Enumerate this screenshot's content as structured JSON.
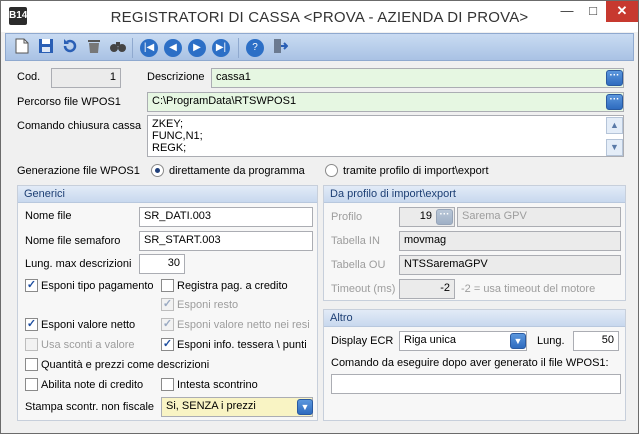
{
  "window": {
    "title": "REGISTRATORI DI CASSA <PROVA - AZIENDA DI PROVA>",
    "app_icon_text": "B14",
    "min_glyph": "—",
    "max_glyph": "□",
    "close_glyph": "✕"
  },
  "toolbar": {
    "icons": [
      "new-icon",
      "save-icon",
      "undo-icon",
      "delete-icon",
      "search-icon",
      "first-icon",
      "previous-icon",
      "next-icon",
      "last-icon",
      "help-icon",
      "exit-icon"
    ]
  },
  "cod": {
    "label": "Cod.",
    "value": "1"
  },
  "descrizione": {
    "label": "Descrizione",
    "value": "cassa1"
  },
  "percorso": {
    "label": "Percorso file WPOS1",
    "value": "C:\\ProgramData\\RTSWPOS1"
  },
  "comando_chiusura": {
    "label": "Comando chiusura cassa",
    "lines": [
      "ZKEY;",
      "FUNC,N1;",
      "REGK;"
    ]
  },
  "generazione": {
    "label": "Generazione file WPOS1",
    "option1": "direttamente da programma",
    "option2": "tramite profilo di import\\export",
    "selected": "option1"
  },
  "generici": {
    "header": "Generici",
    "nome_file_label": "Nome file",
    "nome_file_value": "SR_DATI.003",
    "semaforo_label": "Nome file semaforo",
    "semaforo_value": "SR_START.003",
    "lung_label": "Lung. max descrizioni",
    "lung_value": "30",
    "esponi_tipo_pagamento": "Esponi tipo pagamento",
    "registra_pag_credito": "Registra pag. a credito",
    "esponi_resto": "Esponi resto",
    "esponi_valore_netto": "Esponi valore netto",
    "esponi_valore_netto_resi": "Esponi valore netto nei resi",
    "usa_sconti": "Usa sconti a valore",
    "esponi_info_tessera": "Esponi info. tessera \\ punti",
    "quantita_prezzi": "Quantità e prezzi come descrizioni",
    "abilita_note": "Abilita note di credito",
    "intesta_scontrino": "Intesta scontrino",
    "stampa_label": "Stampa scontr. non fiscale",
    "stampa_value": "Si, SENZA i prezzi"
  },
  "profilo": {
    "header": "Da profilo di import\\export",
    "profilo_label": "Profilo",
    "profilo_value": "19",
    "profilo_name": "Sarema GPV",
    "tabella_in_label": "Tabella IN",
    "tabella_in_value": "movmag",
    "tabella_ou_label": "Tabella OU",
    "tabella_ou_value": "NTSSaremaGPV",
    "timeout_label": "Timeout (ms)",
    "timeout_value": "-2",
    "timeout_hint": "-2 = usa timeout del motore"
  },
  "altro": {
    "header": "Altro",
    "display_label": "Display ECR",
    "display_value": "Riga unica",
    "lung_label": "Lung.",
    "lung_value": "50",
    "comando_label": "Comando da eseguire dopo aver generato il file WPOS1:",
    "comando_value": ""
  },
  "glyphs": {
    "dots": "···",
    "check": "✓",
    "up": "▲",
    "down": "▼",
    "drop": "▼"
  }
}
